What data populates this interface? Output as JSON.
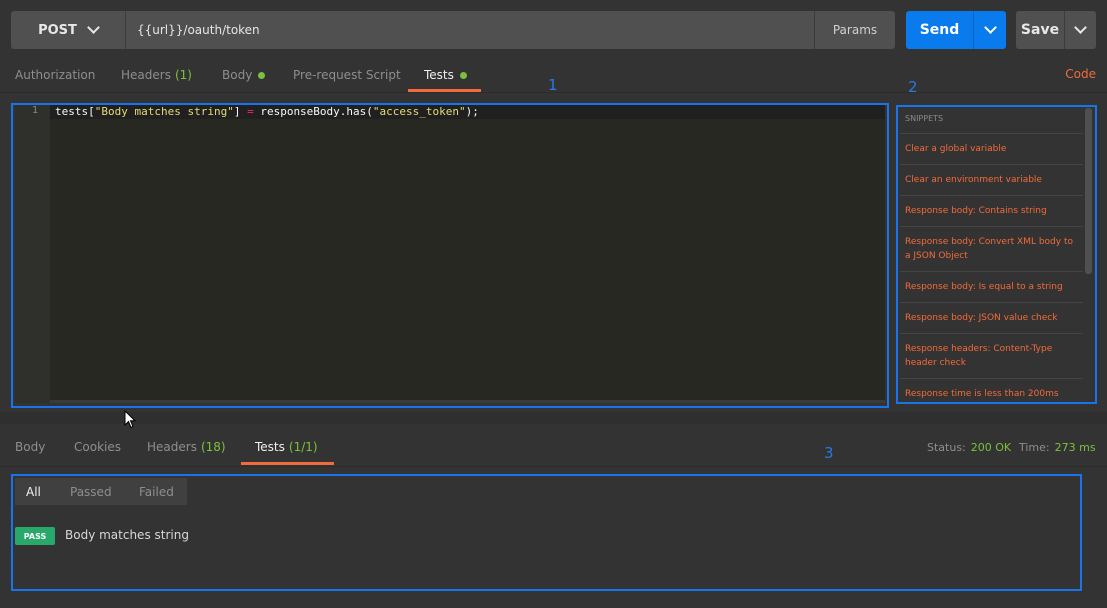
{
  "request": {
    "method": "POST",
    "url": "{{url}}/oauth/token",
    "params_label": "Params",
    "send_label": "Send",
    "save_label": "Save"
  },
  "request_tabs": {
    "authorization": "Authorization",
    "headers": "Headers",
    "headers_count": "(1)",
    "body": "Body",
    "prerequest": "Pre-request Script",
    "tests": "Tests",
    "code": "Code"
  },
  "editor": {
    "line_number": "1",
    "code_parts": [
      "tests[",
      "\"Body matches string\"",
      "] ",
      "=",
      " responseBody.has(",
      "\"access_token\"",
      ");"
    ]
  },
  "snippets": {
    "header": "SNIPPETS",
    "items": [
      "Clear a global variable",
      "Clear an environment variable",
      "Response body: Contains string",
      "Response body: Convert XML body to a JSON Object",
      "Response body: Is equal to a string",
      "Response body: JSON value check",
      "Response headers: Content-Type header check",
      "Response time is less than 200ms"
    ]
  },
  "response_tabs": {
    "body": "Body",
    "cookies": "Cookies",
    "headers": "Headers",
    "headers_count": "(18)",
    "tests": "Tests",
    "tests_count": "(1/1)",
    "status_label": "Status:",
    "status_value": "200 OK",
    "time_label": "Time:",
    "time_value": "273 ms"
  },
  "test_filters": {
    "all": "All",
    "passed": "Passed",
    "failed": "Failed"
  },
  "results": [
    {
      "badge": "PASS",
      "name": "Body matches string"
    }
  ],
  "annotations": [
    "1",
    "2",
    "3"
  ],
  "colors": {
    "accent": "#f26b3a",
    "send": "#097bed",
    "green": "#7bc13e",
    "pass_badge": "#28a86a",
    "annotation": "#1a73e8"
  }
}
